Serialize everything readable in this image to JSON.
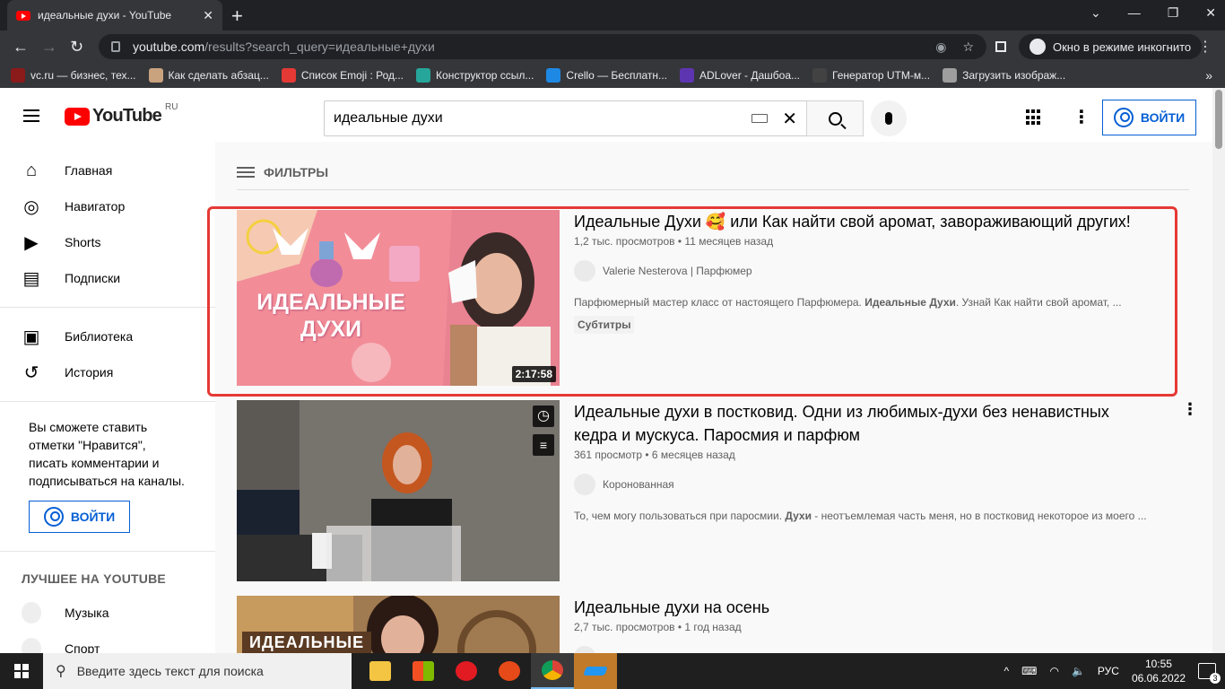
{
  "browser": {
    "tab_title": "идеальные духи - YouTube",
    "url_host": "youtube.com",
    "url_path": "/results?search_query=идеальные+духи",
    "incognito_label": "Окно в режиме инкогнито",
    "bookmarks": [
      {
        "label": "vc.ru — бизнес, тех...",
        "color": "#8b1a1a"
      },
      {
        "label": "Как сделать абзац...",
        "color": "#c9a27e"
      },
      {
        "label": "Список Emoji : Род...",
        "color": "#e53935"
      },
      {
        "label": "Конструктор ссыл...",
        "color": "#26a69a"
      },
      {
        "label": "Crello — Бесплатн...",
        "color": "#1e88e5"
      },
      {
        "label": "ADLover - Дашбоа...",
        "color": "#5e35b1"
      },
      {
        "label": "Генератор UTM-м...",
        "color": "#424242"
      },
      {
        "label": "Загрузить изображ...",
        "color": "#9e9e9e"
      }
    ]
  },
  "header": {
    "logo_text": "YouTube",
    "region": "RU",
    "search_value": "идеальные духи",
    "signin_label": "ВОЙТИ"
  },
  "sidebar": {
    "items": [
      {
        "label": "Главная",
        "icon": "home-icon"
      },
      {
        "label": "Навигатор",
        "icon": "compass-icon"
      },
      {
        "label": "Shorts",
        "icon": "shorts-icon"
      },
      {
        "label": "Подписки",
        "icon": "subscriptions-icon"
      }
    ],
    "items2": [
      {
        "label": "Библиотека",
        "icon": "library-icon"
      },
      {
        "label": "История",
        "icon": "history-icon"
      }
    ],
    "promo": "Вы сможете ставить отметки \"Нравится\", писать комментарии и подписываться на каналы.",
    "signin_label": "ВОЙТИ",
    "best_heading": "ЛУЧШЕЕ НА YOUTUBE",
    "best_items": [
      "Музыка",
      "Спорт"
    ]
  },
  "filters_label": "ФИЛЬТРЫ",
  "results": [
    {
      "title": "Идеальные Духи 🥰 или Как найти свой аромат, завораживающий других!",
      "views": "1,2 тыс. просмотров",
      "age": "11 месяцев назад",
      "channel": "Valerie Nesterova | Парфюмер",
      "desc_before": "Парфюмерный мастер класс от настоящего Парфюмера. ",
      "desc_bold": "Идеальные Духи",
      "desc_after": ". Узнай Как найти свой аромат, ...",
      "badge": "Субтитры",
      "duration": "2:17:58",
      "thumb_text": "ИДЕАЛЬНЫЕ ДУХИ"
    },
    {
      "title": "Идеальные духи в постковид. Одни из любимых-духи без ненавистных кедра и мускуса. Паросмия и парфюм",
      "views": "361 просмотр",
      "age": "6 месяцев назад",
      "channel": "Коронованная",
      "desc_before": "То, чем могу пользоваться при паросмии. ",
      "desc_bold": "Духи",
      "desc_after": " - неотъемлемая часть меня, но в постковид некоторое из моего ..."
    },
    {
      "title": "Идеальные духи на осень",
      "views": "2,7 тыс. просмотров",
      "age": "1 год назад",
      "thumb_text": "ИДЕАЛЬНЫЕ"
    }
  ],
  "taskbar": {
    "search_placeholder": "Введите здесь текст для поиска",
    "lang": "РУС",
    "time": "10:55",
    "date": "06.06.2022",
    "notifications": "3"
  }
}
